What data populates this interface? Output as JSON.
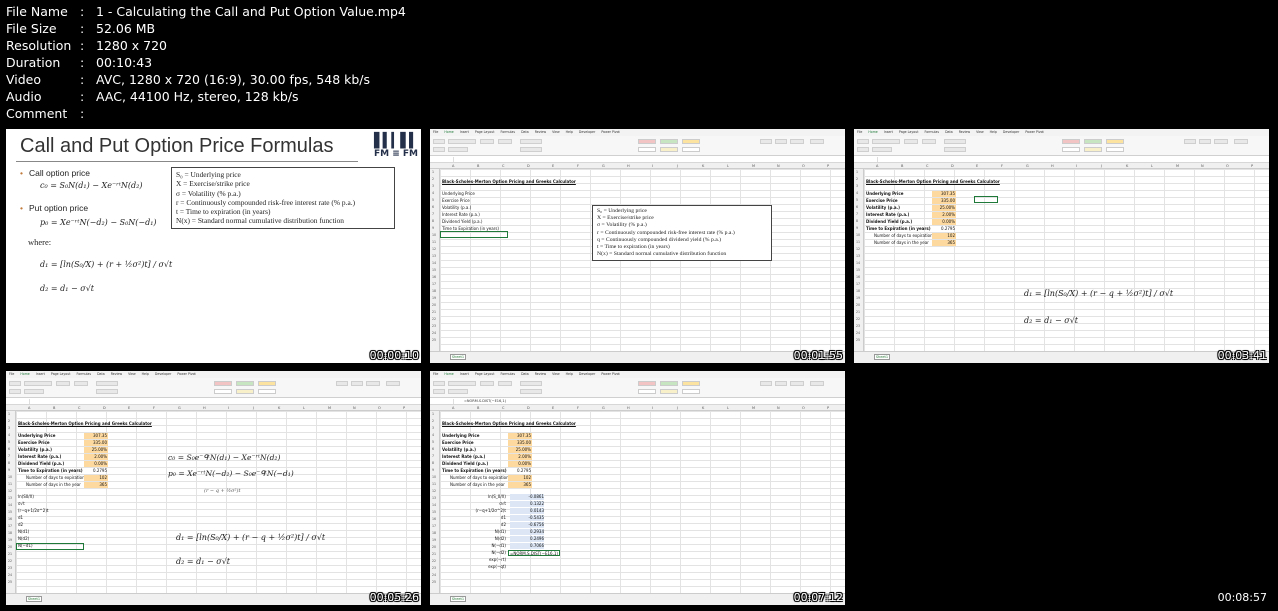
{
  "file_info": {
    "rows": [
      {
        "key": "File Name",
        "value": "1 - Calculating the Call and Put Option Value.mp4"
      },
      {
        "key": "File Size",
        "value": "52.06 MB"
      },
      {
        "key": "Resolution",
        "value": "1280 x 720"
      },
      {
        "key": "Duration",
        "value": "00:10:43"
      },
      {
        "key": "Video",
        "value": "AVC, 1280 x 720 (16:9), 30.00 fps, 548 kb/s"
      },
      {
        "key": "Audio",
        "value": "AAC, 44100 Hz, stereo, 128 kb/s"
      },
      {
        "key": "Comment",
        "value": ""
      }
    ],
    "separator": ":"
  },
  "thumbnails": [
    {
      "timestamp": "00:00:10"
    },
    {
      "timestamp": "00:01:55"
    },
    {
      "timestamp": "00:03:41"
    },
    {
      "timestamp": "00:05:26"
    },
    {
      "timestamp": "00:07:12"
    },
    {
      "timestamp": "00:08:57"
    }
  ],
  "slide": {
    "title": "Call and Put Option Price Formulas",
    "logo": "FM ≡ FM",
    "call_label": "Call option price",
    "call_formula": "c₀ = S₀N(d₁) − Xe⁻ʳᵗN(d₂)",
    "put_label": "Put option price",
    "put_formula": "p₀ = Xe⁻ʳᵗN(−d₂) − S₀N(−d₁)",
    "where": "where:",
    "d1_formula": "d₁ = [ln(S₀/X) + (r + ½σ²)t] / σ√t",
    "d2_formula": "d₂ = d₁ − σ√t",
    "legend": [
      "S₀ = Underlying price",
      "X = Exercise/strike price",
      "σ = Volatility (% p.a.)",
      "r = Continuously compounded risk-free interest rate (% p.a.)",
      "t = Time to expiration (in years)",
      "N(x) = Standard normal cumulative distribution function"
    ]
  },
  "excel": {
    "ribbon_tabs": [
      "File",
      "Home",
      "Insert",
      "Page Layout",
      "Formulas",
      "Data",
      "Review",
      "View",
      "Help",
      "Developer",
      "Power Pivot"
    ],
    "columns": [
      "A",
      "B",
      "C",
      "D",
      "E",
      "F",
      "G",
      "H",
      "I",
      "J",
      "K",
      "L",
      "M",
      "N",
      "O",
      "P"
    ],
    "sheet_tab": "Sheet1",
    "title": "Black-Scholes-Merton Option Pricing and Greeks Calculator",
    "labels": [
      "Underlying Price",
      "Exercise Price",
      "Volatility (p.a.)",
      "Interest Rate (p.a.)",
      "Dividend Yield (p.a.)",
      "Time to Expiration (in years)",
      "Number of days to expiration",
      "Number of days in the year"
    ],
    "values": [
      "307.35",
      "335.00",
      "25.00%",
      "2.00%",
      "0.00%",
      "0.2795",
      "102",
      "365"
    ],
    "legend2": [
      "S₀ = Underlying price",
      "X = Exercise/strike price",
      "σ = Volatility (% p.a.)",
      "r = Continuously compounded risk-free interest rate (% p.a.)",
      "q = Continuously compounded dividend yield (% p.a.)",
      "t = Time to expiration (in years)",
      "N(x) = Standard normal cumulative distribution function"
    ],
    "d1_formula": "d₁ = [ln(S₀/X) + (r − q + ½σ²)t] / σ√t",
    "d2_formula": "d₂ = d₁ − σ√t",
    "c_formula": "c₀ = S₀e⁻ᑫᵗN(d₁) − Xe⁻ʳᵗN(d₂)",
    "p_formula": "p₀ = Xe⁻ʳᵗN(−d₂) − S₀e⁻ᑫᵗN(−d₁)",
    "partial_formula": "(r − q + ½σ²)t",
    "t4_calc_labels": [
      "ln(S0/X)",
      "σ√t",
      "(r−q+1/2σ^2)t",
      "d1",
      "d2",
      "N(d1)",
      "N(d2)",
      "N(−d1)"
    ],
    "t5_calc_labels": [
      "ln(S_0/X)",
      "σ√t",
      "(r−q+1/2σ^2)t",
      "d1",
      "d2",
      "N(d1)",
      "N(d2)",
      "N(−d1)",
      "N(−d2)",
      "exp(−rt)",
      "exp(−qt)"
    ],
    "t5_calc_values": [
      "-0.0861",
      "0.1322",
      "0.0143",
      "-0.5435",
      "-0.6756",
      "0.2934",
      "0.2496",
      "0.7066",
      "=NORM.S.DIST(−E16,1)"
    ],
    "t5_fbar": "=NORM.S.DIST(−E16,1)"
  }
}
